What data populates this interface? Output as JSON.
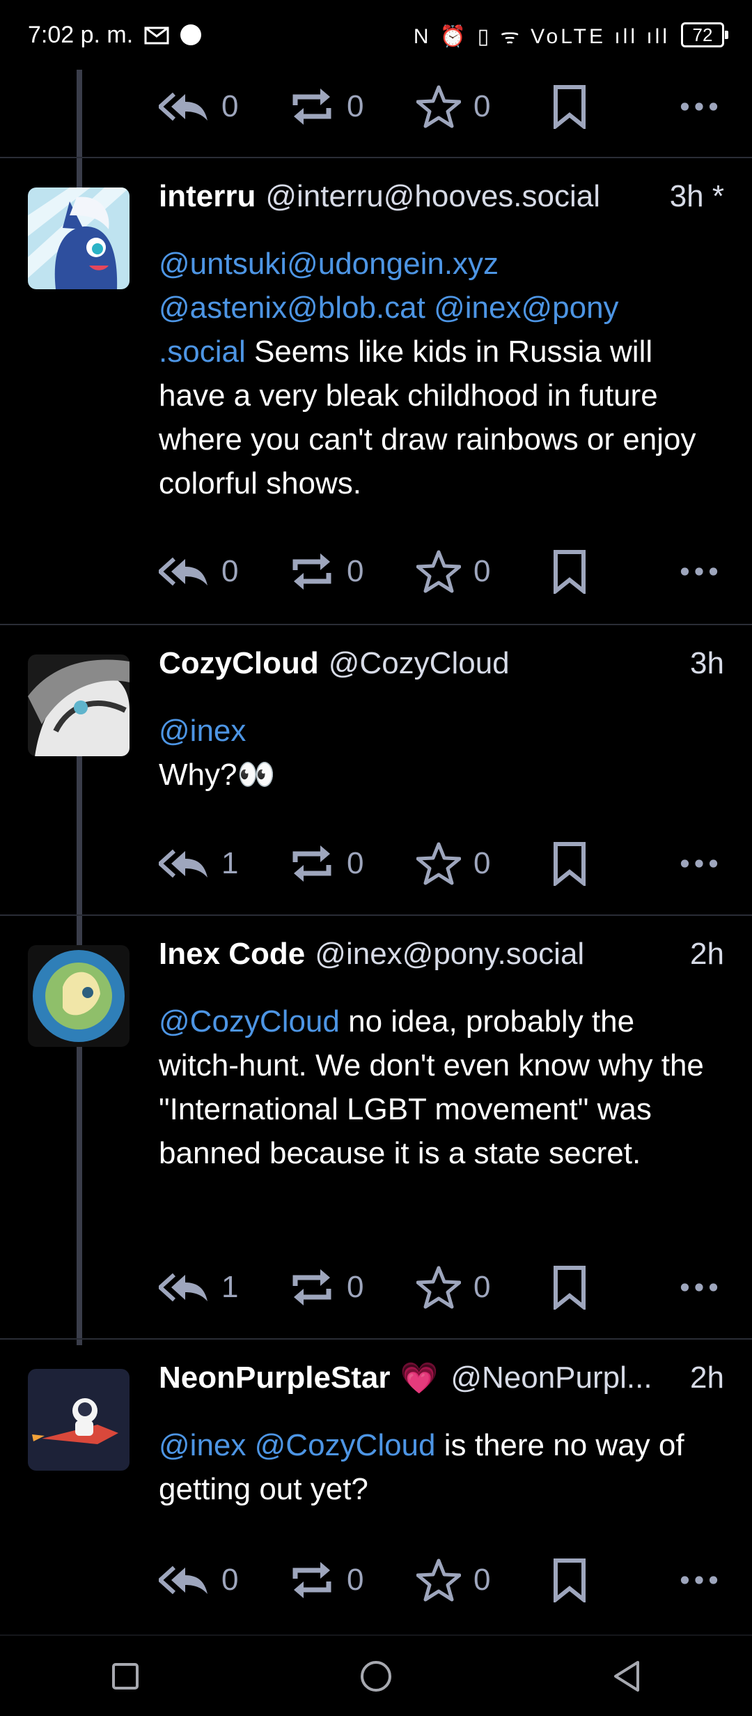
{
  "status_bar": {
    "time": "7:02 p. m.",
    "left_icons": "gmail-icon",
    "right_icons_text": "N ⏰ ▯ ᯤ VoLTE ıll ıll",
    "battery": "72"
  },
  "colors": {
    "background": "#000000",
    "mention": "#4d95e4",
    "action_icon": "#9ea6bd",
    "thread_line": "#3a3d4a"
  },
  "top_actions": {
    "replies": "0",
    "boosts": "0",
    "favourites": "0"
  },
  "posts": [
    {
      "display_name": "interru",
      "handle": "@interru@hooves.social",
      "time": "3h *",
      "mentions": [
        "@untsuki@udongein.xyz",
        "@astenix@blob.cat",
        "@inex@pony",
        ".social"
      ],
      "text": "Seems like kids in Russia will have a very bleak childhood in future where you can't draw rainbows or enjoy colorful shows.",
      "replies": "0",
      "boosts": "0",
      "favourites": "0"
    },
    {
      "display_name": "CozyCloud",
      "handle": "@CozyCloud",
      "time": "3h",
      "mentions": [
        "@inex"
      ],
      "text": "Why?👀",
      "replies": "1",
      "boosts": "0",
      "favourites": "0"
    },
    {
      "display_name": "Inex Code",
      "handle": "@inex@pony.social",
      "time": "2h",
      "mentions": [
        "@CozyCloud"
      ],
      "text": "no idea, probably the witch-hunt. We don't even know why the \"International LGBT movement\" was banned because it is a state secret.",
      "replies": "1",
      "boosts": "0",
      "favourites": "0"
    },
    {
      "display_name": "NeonPurpleStar",
      "badge": "💗",
      "handle": "@NeonPurpl...",
      "time": "2h",
      "mentions": [
        "@inex",
        "@CozyCloud"
      ],
      "text": "is there no way of getting out yet?",
      "replies": "0",
      "boosts": "0",
      "favourites": "0"
    }
  ],
  "nav": {
    "items": [
      "recents-square-icon",
      "home-circle-icon",
      "back-triangle-icon"
    ]
  }
}
